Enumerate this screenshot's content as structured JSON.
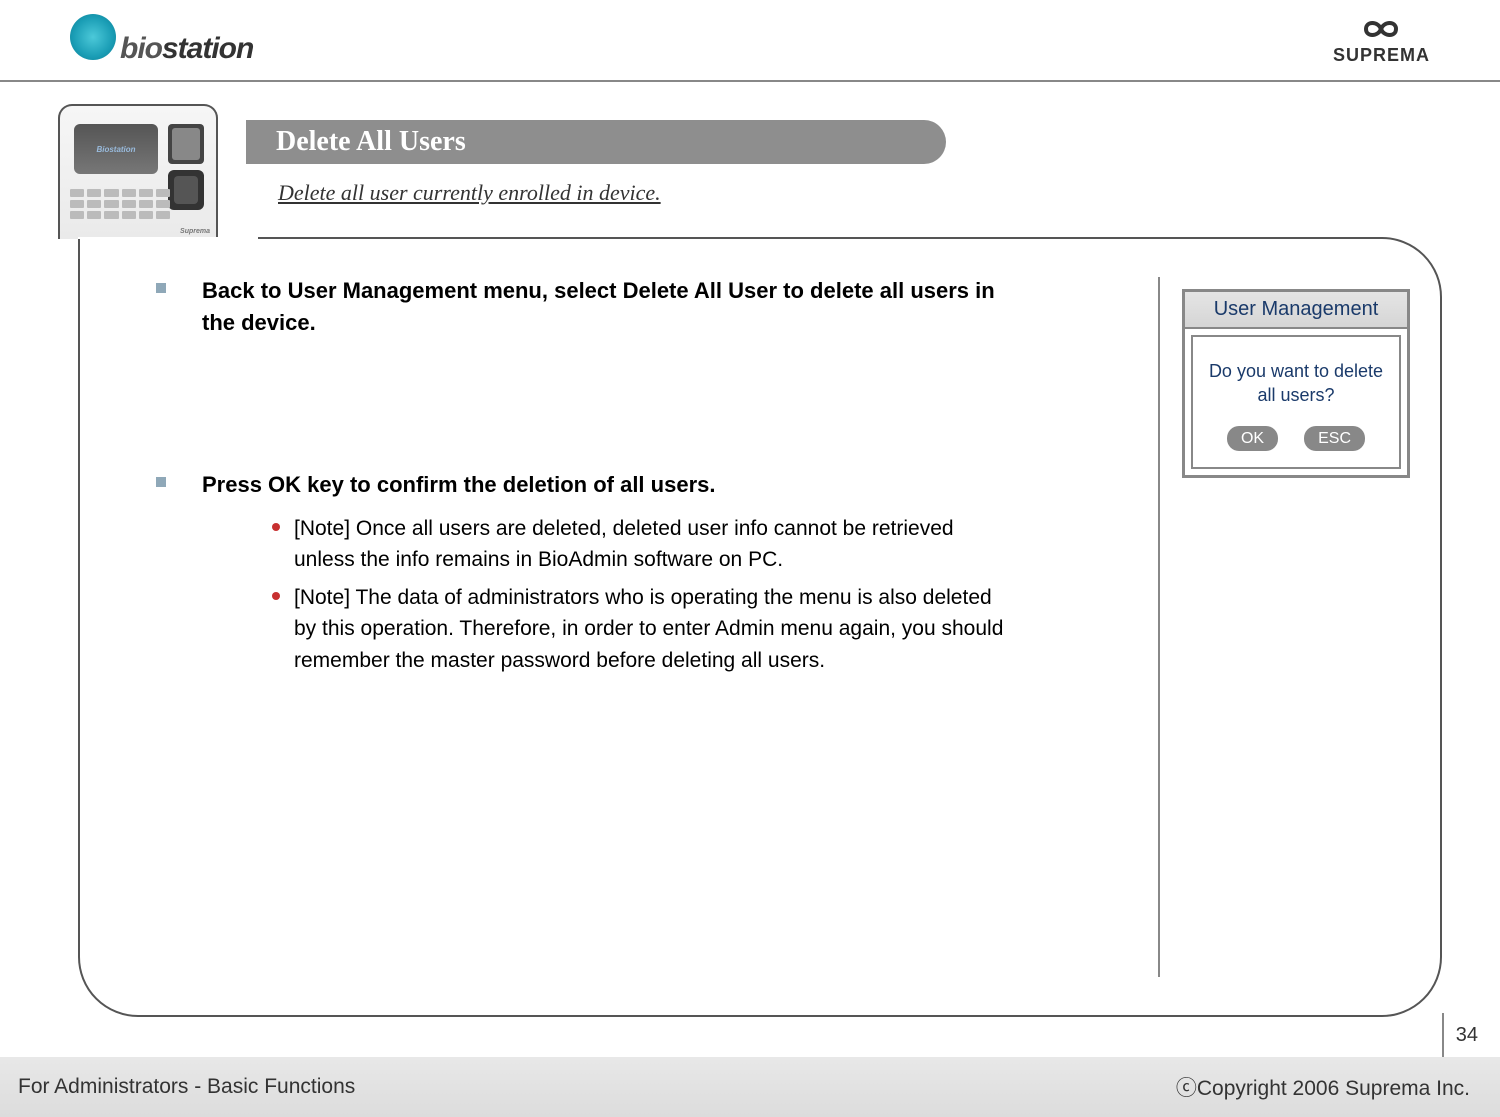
{
  "header": {
    "logo_left_prefix": "bio",
    "logo_left_suffix": "station",
    "logo_right": "SUPREMA"
  },
  "section": {
    "title": "Delete All Users",
    "subtitle": "Delete all user currently enrolled in device.",
    "device_screen_label": "Biostation",
    "device_brand": "Suprema"
  },
  "instructions": {
    "item1": "Back to User Management menu, select Delete All User to delete all users in the device.",
    "item2": {
      "heading": "Press OK key to confirm the deletion of all users.",
      "note1": "[Note] Once all users are deleted, deleted user info cannot be retrieved unless the info remains in BioAdmin software on PC.",
      "note2": "[Note] The data of administrators who is operating the menu is also deleted by this operation. Therefore, in order to enter Admin menu again, you should remember the master password before deleting all users."
    }
  },
  "device_dialog": {
    "header": "User Management",
    "message_line1": "Do you want to delete",
    "message_line2": "all users?",
    "ok_label": "OK",
    "esc_label": "ESC"
  },
  "footer": {
    "left": "For Administrators - Basic Functions",
    "right": "ⓒCopyright 2006 Suprema Inc.",
    "page_number": "34"
  }
}
